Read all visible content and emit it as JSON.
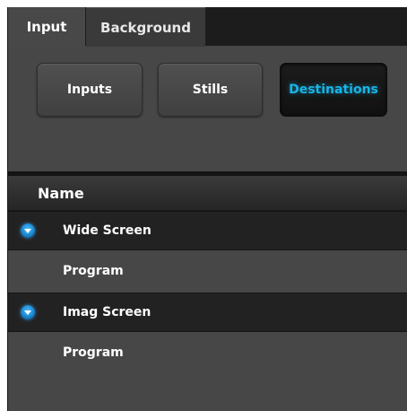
{
  "tabs": [
    {
      "label": "Input",
      "active": true
    },
    {
      "label": "Background",
      "active": false
    }
  ],
  "buttons": [
    {
      "label": "Inputs",
      "active": false
    },
    {
      "label": "Stills",
      "active": false
    },
    {
      "label": "Destinations",
      "active": true
    }
  ],
  "list": {
    "header": "Name",
    "groups": [
      {
        "label": "Wide Screen",
        "icon": "chevron-down-icon",
        "items": [
          "Program"
        ]
      },
      {
        "label": "Imag Screen",
        "icon": "chevron-down-icon",
        "items": [
          "Program"
        ]
      }
    ]
  },
  "colors": {
    "accent": "#19b4e6",
    "panel": "#474747",
    "group_row": "#222222"
  }
}
